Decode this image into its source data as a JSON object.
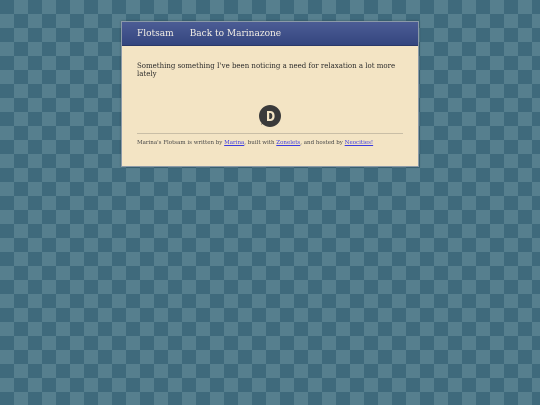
{
  "nav": {
    "items": [
      {
        "label": "Flotsam"
      },
      {
        "label": "Back to Marinazone"
      }
    ]
  },
  "post": {
    "text": "Something something I've been noticing a need for relaxation a lot more lately"
  },
  "footer": {
    "prefix": "Marina's Flotsam is written by ",
    "author_link": "Marina",
    "mid1": ", built with ",
    "builder_link": "Zonelets",
    "mid2": ", and hosted by ",
    "host_link": "Neocities!"
  },
  "colors": {
    "background": "#3f6a7c",
    "navbar": "#3d4f8a",
    "panel": "#f3e4c4",
    "link": "#3a3ae0"
  },
  "icons": {
    "comments": "disqus-logo-icon"
  }
}
